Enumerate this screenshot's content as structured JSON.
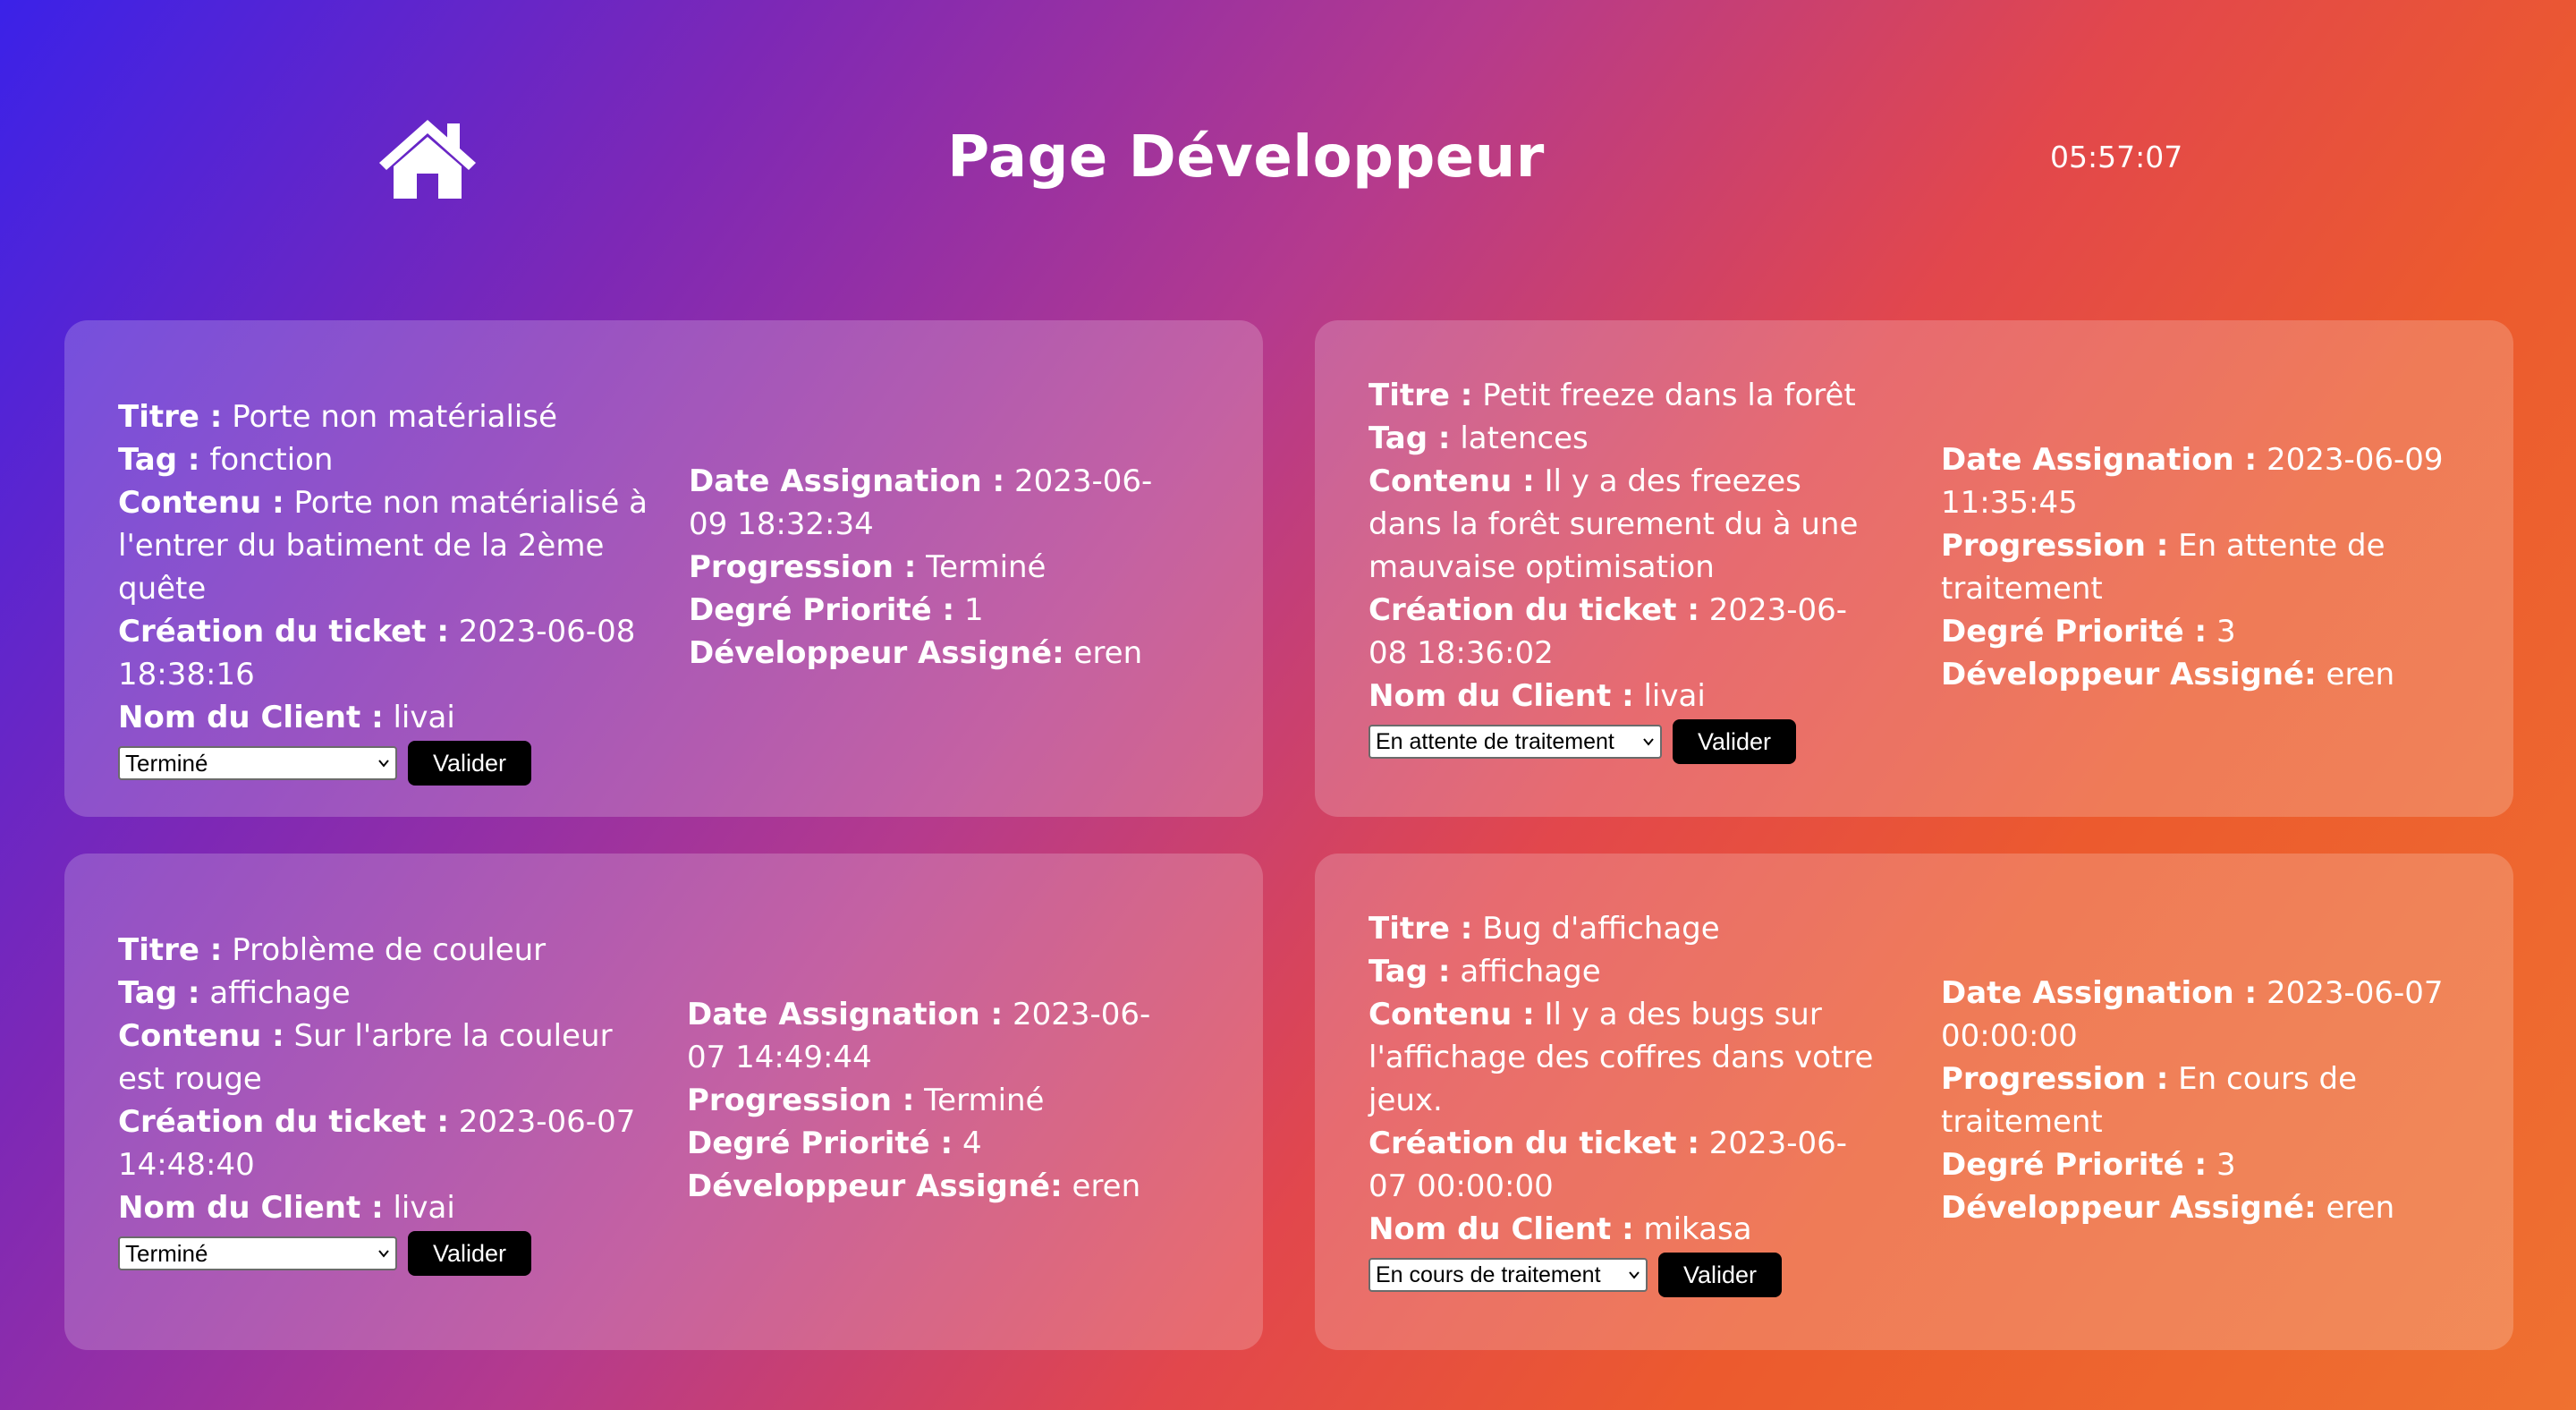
{
  "header": {
    "title": "Page Développeur",
    "clock": "05:57:07",
    "home_icon": "home-icon"
  },
  "labels": {
    "titre": "Titre :",
    "tag": "Tag :",
    "contenu": "Contenu :",
    "creation": "Création du ticket :",
    "client": "Nom du Client :",
    "date_assignation": "Date Assignation :",
    "progression": "Progression :",
    "priorite": "Degré Priorité :",
    "developpeur": "Développeur Assigné:"
  },
  "tickets": [
    {
      "titre": "Porte non matérialisé",
      "tag": "fonction",
      "contenu": "Porte non matérialisé à l'entrer du batiment de la 2ème quête",
      "creation": "2023-06-08 18:38:16",
      "client": "livai",
      "date_assignation": "2023-06-09 18:32:34",
      "progression": "Terminé",
      "priorite": "1",
      "developpeur": "eren",
      "select_value": "Terminé",
      "button": "Valider"
    },
    {
      "titre": "Petit freeze dans la forêt",
      "tag": "latences",
      "contenu": "Il y a des freezes dans la forêt surement du à une mauvaise optimisation",
      "creation": "2023-06-08 18:36:02",
      "client": "livai",
      "date_assignation": "2023-06-09 11:35:45",
      "progression": "En attente de traitement",
      "priorite": "3",
      "developpeur": "eren",
      "select_value": "En attente de traitement",
      "button": "Valider"
    },
    {
      "titre": "Problème de couleur",
      "tag": "affichage",
      "contenu": "Sur l'arbre la couleur est rouge",
      "creation": "2023-06-07 14:48:40",
      "client": "livai",
      "date_assignation": "2023-06-07 14:49:44",
      "progression": "Terminé",
      "priorite": "4",
      "developpeur": "eren",
      "select_value": "Terminé",
      "button": "Valider"
    },
    {
      "titre": "Bug d'affichage",
      "tag": "affichage",
      "contenu": "Il y a des bugs sur l'affichage des coffres dans votre jeux.",
      "creation": "2023-06-07 00:00:00",
      "client": "mikasa",
      "date_assignation": "2023-06-07 00:00:00",
      "progression": "En cours de traitement",
      "priorite": "3",
      "developpeur": "eren",
      "select_value": "En cours de traitement",
      "button": "Valider"
    }
  ]
}
